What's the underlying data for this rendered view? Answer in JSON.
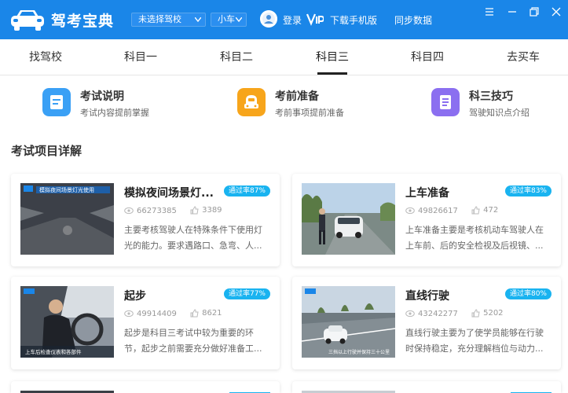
{
  "titlebar": {
    "app_name": "驾考宝典",
    "school_select": "未选择驾校",
    "car_select": "小车",
    "login": "登录",
    "download": "下载手机版",
    "sync": "同步数据"
  },
  "tabs": [
    {
      "label": "找驾校"
    },
    {
      "label": "科目一"
    },
    {
      "label": "科目二"
    },
    {
      "label": "科目三"
    },
    {
      "label": "科目四"
    },
    {
      "label": "去买车"
    }
  ],
  "active_tab": "科目三",
  "quick_links": [
    {
      "title": "考试说明",
      "subtitle": "考试内容提前掌握",
      "icon": "document-icon",
      "color": "#3aa0f5"
    },
    {
      "title": "考前准备",
      "subtitle": "考前事项提前准备",
      "icon": "car-front-icon",
      "color": "#f7a51b"
    },
    {
      "title": "科三技巧",
      "subtitle": "驾驶知识点介绍",
      "icon": "note-icon",
      "color": "#8b6ff0"
    }
  ],
  "section_title": "考试项目详解",
  "cards": [
    {
      "title": "模拟夜间场景灯...",
      "badge": "通过率87%",
      "views": "66273385",
      "likes": "3389",
      "desc": "主要考核驾驶人在特殊条件下使用灯光的能力。要求遇路口、急弯、人...",
      "thumb_text": "模拟夜间场景灯光使用"
    },
    {
      "title": "上车准备",
      "badge": "通过率83%",
      "views": "49826617",
      "likes": "472",
      "desc": "上车准备主要是考核机动车驾驶人在上车前、后的安全检视及后视镜、..."
    },
    {
      "title": "起步",
      "badge": "通过率77%",
      "views": "49914409",
      "likes": "8621",
      "desc": "起步是科目三考试中较为重要的环节，起步之前需要充分做好准备工...",
      "thumb_text": "上车后检查仪表和各部件"
    },
    {
      "title": "直线行驶",
      "badge": "通过率80%",
      "views": "43242277",
      "likes": "5202",
      "desc": "直线行驶主要为了使学员能够在行驶时保持稳定，充分理解档位与动力...",
      "thumb_text": "三挡以上行驶并保持三十公里"
    }
  ],
  "colors": {
    "titlebar": "#1a86e8",
    "badge": "#19b3f0"
  }
}
